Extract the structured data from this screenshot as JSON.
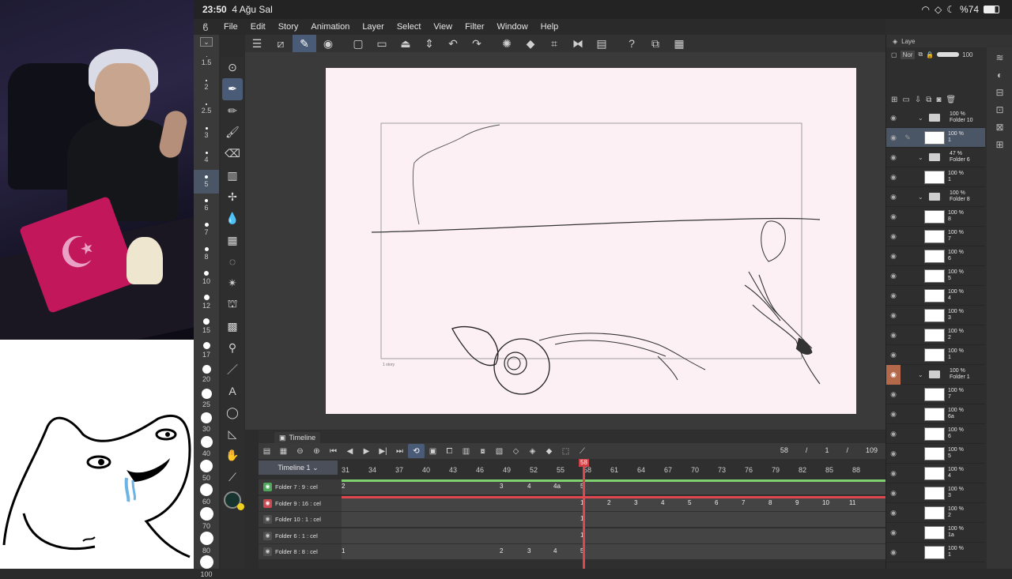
{
  "status": {
    "time": "23:50",
    "date": "4 Ağu Sal",
    "battery": "%74"
  },
  "menu": [
    "File",
    "Edit",
    "Story",
    "Animation",
    "Layer",
    "Select",
    "View",
    "Filter",
    "Window",
    "Help"
  ],
  "brush_sizes": [
    {
      "label": "1.5",
      "d": 1
    },
    {
      "label": "2",
      "d": 2
    },
    {
      "label": "2.5",
      "d": 2
    },
    {
      "label": "3",
      "d": 3
    },
    {
      "label": "4",
      "d": 3
    },
    {
      "label": "5",
      "d": 4,
      "sel": true
    },
    {
      "label": "6",
      "d": 4
    },
    {
      "label": "7",
      "d": 5
    },
    {
      "label": "8",
      "d": 5
    },
    {
      "label": "10",
      "d": 6
    },
    {
      "label": "12",
      "d": 7
    },
    {
      "label": "15",
      "d": 8
    },
    {
      "label": "17",
      "d": 9
    },
    {
      "label": "20",
      "d": 11
    },
    {
      "label": "25",
      "d": 13
    },
    {
      "label": "30",
      "d": 14
    },
    {
      "label": "40",
      "d": 15
    },
    {
      "label": "50",
      "d": 16
    },
    {
      "label": "60",
      "d": 16
    },
    {
      "label": "70",
      "d": 17
    },
    {
      "label": "80",
      "d": 17
    },
    {
      "label": "100",
      "d": 17
    }
  ],
  "canvas": {
    "frame_label": "1 story"
  },
  "timeline": {
    "tab": "Timeline",
    "name": "Timeline 1",
    "current_frame": "58",
    "page": "1",
    "total_frames": "109",
    "ruler": [
      "31",
      "34",
      "37",
      "40",
      "43",
      "46",
      "49",
      "52",
      "55",
      "58",
      "61",
      "64",
      "67",
      "70",
      "73",
      "76",
      "79",
      "82",
      "85",
      "88"
    ],
    "tracks": [
      {
        "label": "Folder 7 : 9 : cel",
        "eye": "g",
        "bar": "#7fd26d",
        "cells": [
          "2",
          "3",
          "4",
          "4a",
          "5"
        ]
      },
      {
        "label": "Folder 9 : 16 : cel",
        "eye": "r",
        "bar": "#e0464d",
        "cells": [
          "1",
          "2",
          "3",
          "4",
          "5",
          "6",
          "7",
          "8",
          "9",
          "10",
          "11"
        ]
      },
      {
        "label": "Folder 10 : 1 : cel",
        "eye": "",
        "bar": "",
        "cells": [
          "1"
        ]
      },
      {
        "label": "Folder 6 : 1 : cel",
        "eye": "",
        "bar": "",
        "cells": [
          "1"
        ]
      },
      {
        "label": "Folder 8 : 8 : cel",
        "eye": "",
        "bar": "",
        "cells": [
          "1",
          "2",
          "3",
          "4",
          "5"
        ]
      }
    ]
  },
  "layers": {
    "title": "Laye",
    "blend": "Nor",
    "opacity": "100",
    "rows": [
      {
        "type": "folder",
        "pct": "100 %",
        "name": "Folder 10"
      },
      {
        "type": "layer",
        "pct": "100 %",
        "name": "1",
        "sel": true
      },
      {
        "type": "folder",
        "pct": "47 %",
        "name": "Folder 6"
      },
      {
        "type": "layer",
        "pct": "100 %",
        "name": "1"
      },
      {
        "type": "folder",
        "pct": "100 %",
        "name": "Folder 8"
      },
      {
        "type": "layer",
        "pct": "100 %",
        "name": "8"
      },
      {
        "type": "layer",
        "pct": "100 %",
        "name": "7"
      },
      {
        "type": "layer",
        "pct": "100 %",
        "name": "6"
      },
      {
        "type": "layer",
        "pct": "100 %",
        "name": "5"
      },
      {
        "type": "layer",
        "pct": "100 %",
        "name": "4"
      },
      {
        "type": "layer",
        "pct": "100 %",
        "name": "3"
      },
      {
        "type": "layer",
        "pct": "100 %",
        "name": "2"
      },
      {
        "type": "layer",
        "pct": "100 %",
        "name": "1"
      },
      {
        "type": "folder",
        "pct": "100 %",
        "name": "Folder 1",
        "orange": true
      },
      {
        "type": "layer",
        "pct": "100 %",
        "name": "7"
      },
      {
        "type": "layer",
        "pct": "100 %",
        "name": "6a"
      },
      {
        "type": "layer",
        "pct": "100 %",
        "name": "6"
      },
      {
        "type": "layer",
        "pct": "100 %",
        "name": "5"
      },
      {
        "type": "layer",
        "pct": "100 %",
        "name": "4"
      },
      {
        "type": "layer",
        "pct": "100 %",
        "name": "3"
      },
      {
        "type": "layer",
        "pct": "100 %",
        "name": "2"
      },
      {
        "type": "layer",
        "pct": "100 %",
        "name": "1a"
      },
      {
        "type": "layer",
        "pct": "100 %",
        "name": "1"
      }
    ]
  },
  "colors": {
    "accent": "#4a5b78",
    "paper": "#fcf0f5",
    "playhead": "#e0464d"
  }
}
